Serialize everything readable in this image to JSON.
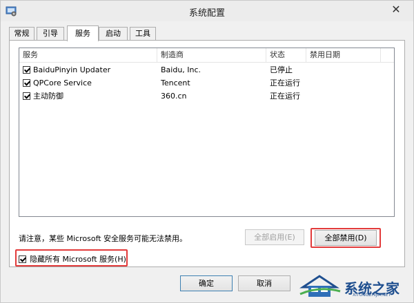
{
  "window": {
    "title": "系统配置"
  },
  "tabs": [
    {
      "label": "常规"
    },
    {
      "label": "引导"
    },
    {
      "label": "服务",
      "active": true
    },
    {
      "label": "启动"
    },
    {
      "label": "工具"
    }
  ],
  "services": {
    "columns": [
      "服务",
      "制造商",
      "状态",
      "禁用日期"
    ],
    "rows": [
      {
        "name": "BaiduPinyin Updater",
        "manufacturer": "Baidu, Inc.",
        "status": "已停止",
        "disabled_date": "",
        "checked": true
      },
      {
        "name": "QPCore Service",
        "manufacturer": "Tencent",
        "status": "正在运行",
        "disabled_date": "",
        "checked": true
      },
      {
        "name": "主动防御",
        "manufacturer": "360.cn",
        "status": "正在运行",
        "disabled_date": "",
        "checked": true
      }
    ]
  },
  "note": "请注意，某些 Microsoft 安全服务可能无法禁用。",
  "buttons": {
    "enable_all": "全部启用(E)",
    "disable_all": "全部禁用(D)",
    "ok": "确定",
    "cancel": "取消"
  },
  "hide_microsoft": {
    "label": "隐藏所有 Microsoft 服务(H)",
    "checked": true
  },
  "watermark": {
    "text": "系统之家",
    "url": "XITONGZHIJIA.NET"
  },
  "colors": {
    "highlight_border": "#e23a3a",
    "default_button_border": "#3c7fb1"
  }
}
